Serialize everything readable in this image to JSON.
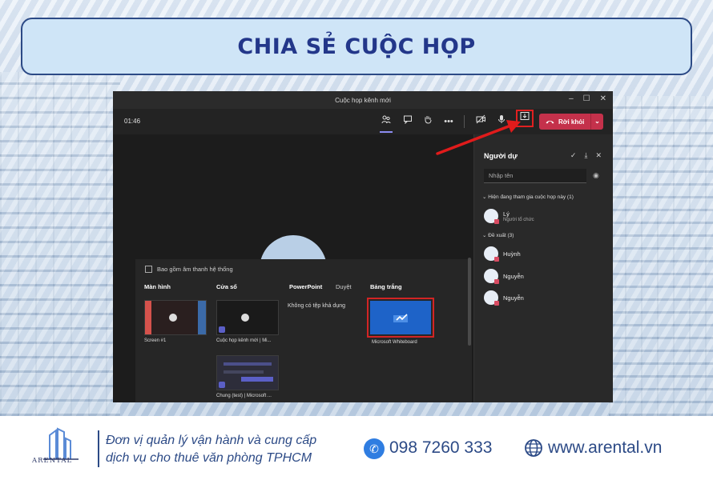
{
  "banner": {
    "title": "CHIA SẺ CUỘC HỌP"
  },
  "window": {
    "title": "Cuộc họp kênh mới",
    "controls": [
      "–",
      "☐",
      "✕"
    ],
    "timer": "01:46",
    "leave_label": "Rời khỏi"
  },
  "share_tray": {
    "include_audio": "Bao gồm âm thanh hệ thống",
    "columns": {
      "screen": "Màn hình",
      "window": "Cửa sổ",
      "powerpoint": "PowerPoint",
      "browse": "Duyệt",
      "whiteboard": "Bảng trắng"
    },
    "screen_item": "Screen #1",
    "window_items": [
      "Cuộc họp kênh mới | Mi...",
      "Chung (test) | Microsoft ..."
    ],
    "no_files": "Không có tệp khả dụng",
    "whiteboard_item": "Microsoft Whiteboard"
  },
  "participants": {
    "title": "Người dự",
    "search_placeholder": "Nhập tên",
    "in_meeting_header": "Hiện đang tham gia cuộc họp này (1)",
    "organizer": {
      "name": "Lý",
      "role": "Người tổ chức"
    },
    "suggested_header": "Đề xuất (3)",
    "suggested": [
      "Huỳnh",
      "Nguyễn",
      "Nguyễn"
    ]
  },
  "footer": {
    "logo_text": "ARENTAL",
    "tagline_1": "Đơn vị quản lý vận hành và cung cấp",
    "tagline_2": "dịch vụ cho thuê văn phòng TPHCM",
    "phone": "098 7260 333",
    "website": "www.arental.vn"
  },
  "colors": {
    "brand_blue": "#2c4a86",
    "leave_red": "#c4314b",
    "highlight_red": "#e02020",
    "whiteboard_blue": "#1e63c8"
  }
}
